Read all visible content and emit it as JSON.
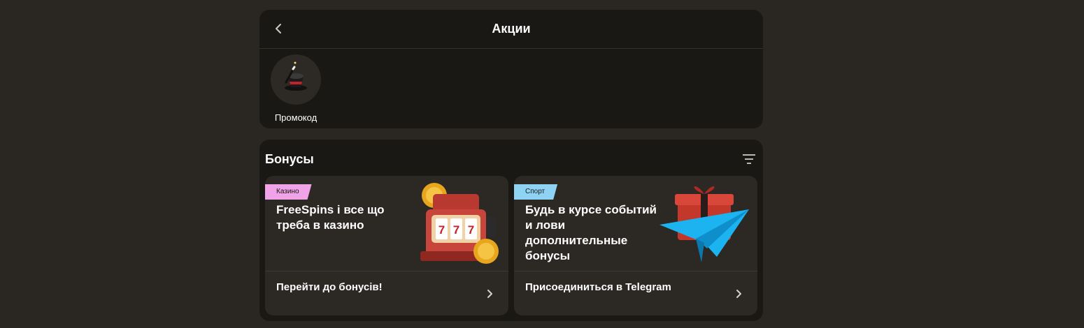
{
  "header": {
    "title": "Акции"
  },
  "promo": {
    "items": [
      {
        "label": "Промокод",
        "icon": "magic-hat-icon"
      }
    ]
  },
  "bonuses": {
    "title": "Бонусы",
    "cards": [
      {
        "tag": "Казино",
        "tag_color": "#f0a3e6",
        "title": "FreeSpins і все що треба в казино",
        "action": "Перейти до бонусів!",
        "art": "slot-machine-icon"
      },
      {
        "tag": "Спорт",
        "tag_color": "#8fd3f4",
        "title": "Будь в курсе событий и лови дополнительные бонусы",
        "action": "Присоединиться в Telegram",
        "art": "telegram-gift-icon"
      }
    ]
  },
  "colors": {
    "page_bg": "#2a2621",
    "panel_bg": "#1a1815",
    "card_bg": "#2c2824"
  }
}
